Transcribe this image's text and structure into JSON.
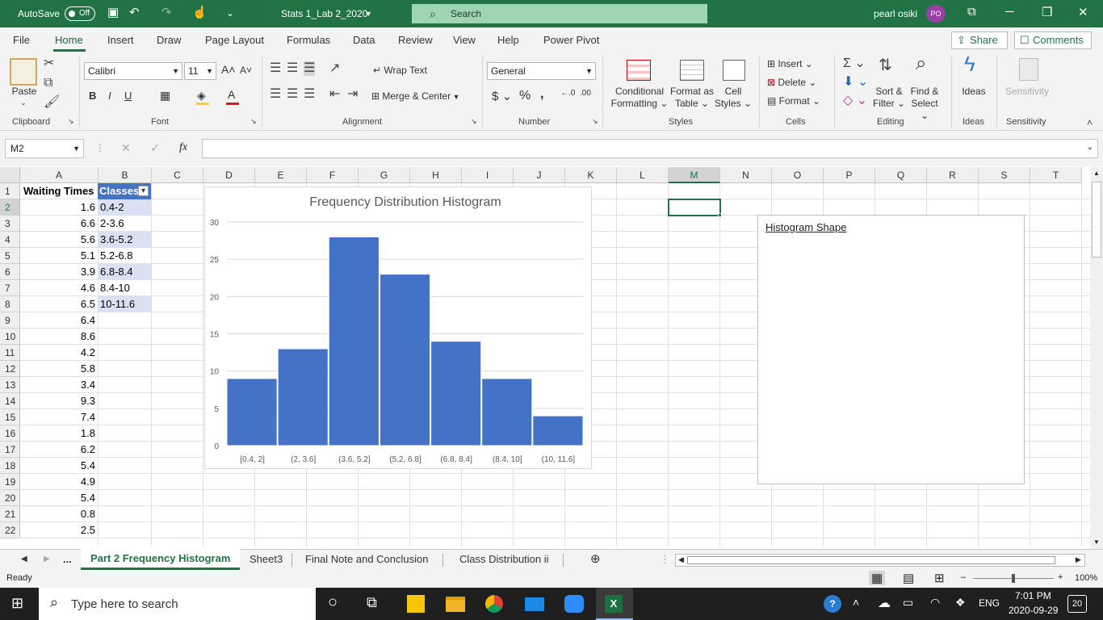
{
  "titlebar": {
    "autosave_label": "AutoSave",
    "autosave_state": "Off",
    "doc_title": "Stats 1_Lab 2_2020",
    "search_placeholder": "Search",
    "user_name": "pearl osiki",
    "user_initials": "PO",
    "bg_color": "#217346"
  },
  "menu": {
    "tabs": [
      "File",
      "Home",
      "Insert",
      "Draw",
      "Page Layout",
      "Formulas",
      "Data",
      "Review",
      "View",
      "Help",
      "Power Pivot"
    ],
    "active": "Home",
    "share_label": "Share",
    "comments_label": "Comments"
  },
  "ribbon": {
    "clipboard": {
      "paste": "Paste",
      "label": "Clipboard"
    },
    "font": {
      "name": "Calibri",
      "size": "11",
      "label": "Font",
      "bold": "B",
      "italic": "I",
      "underline": "U"
    },
    "alignment": {
      "wrap": "Wrap Text",
      "merge": "Merge & Center",
      "label": "Alignment"
    },
    "number": {
      "format": "General",
      "label": "Number"
    },
    "styles": {
      "conditional": "Conditional",
      "conditional2": "Formatting",
      "format_as": "Format as",
      "format_as2": "Table",
      "cell": "Cell",
      "cell2": "Styles",
      "label": "Styles"
    },
    "cells": {
      "insert": "Insert",
      "delete": "Delete",
      "format": "Format",
      "label": "Cells"
    },
    "editing": {
      "sort": "Sort &",
      "sort2": "Filter",
      "find": "Find &",
      "find2": "Select",
      "label": "Editing"
    },
    "ideas": {
      "btn": "Ideas",
      "label": "Ideas"
    },
    "sensitivity": {
      "btn": "Sensitivity",
      "label": "Sensitivity"
    }
  },
  "formula_bar": {
    "name_box": "M2",
    "fx": "fx",
    "value": ""
  },
  "grid": {
    "columns": [
      "A",
      "B",
      "C",
      "D",
      "E",
      "F",
      "G",
      "H",
      "I",
      "J",
      "K",
      "L",
      "M",
      "N",
      "O",
      "P",
      "Q",
      "R",
      "S",
      "T"
    ],
    "rows": [
      "1",
      "2",
      "3",
      "4",
      "5",
      "6",
      "7",
      "8",
      "9",
      "10",
      "11",
      "12",
      "13",
      "14",
      "15",
      "16",
      "17",
      "18",
      "19",
      "20",
      "21",
      "22"
    ],
    "header_a": "Waiting Times",
    "header_b": "Classes",
    "waiting_times": [
      "1.6",
      "6.6",
      "5.6",
      "5.1",
      "3.9",
      "4.6",
      "6.5",
      "6.4",
      "8.6",
      "4.2",
      "5.8",
      "3.4",
      "9.3",
      "7.4",
      "1.8",
      "6.2",
      "5.4",
      "4.9",
      "5.4",
      "0.8",
      "2.5"
    ],
    "classes": [
      "0.4-2",
      "2-3.6",
      "3.6-5.2",
      "5.2-6.8",
      "6.8-8.4",
      "8.4-10",
      "10-11.6"
    ],
    "selected_cell": "M2",
    "selected_col": "M"
  },
  "chart_data": {
    "type": "bar",
    "title": "Frequency Distribution Histogram",
    "categories": [
      "[0.4, 2]",
      "(2, 3.6]",
      "(3.6, 5.2]",
      "(5.2, 6.8]",
      "(6.8, 8.4]",
      "(8.4, 10]",
      "(10, 11.6]"
    ],
    "values": [
      9,
      13,
      28,
      23,
      14,
      9,
      4
    ],
    "ylim": [
      0,
      30
    ],
    "yticks": [
      "0",
      "5",
      "10",
      "15",
      "20",
      "25",
      "30"
    ],
    "grid": true,
    "color": "#4472c4"
  },
  "textbox": {
    "title": "Histogram Shape"
  },
  "sheets": {
    "tabs": [
      "Part 2 Frequency Histogram",
      "Sheet3",
      "Final Note and Conclusion",
      "Class Distribution ii"
    ],
    "active": "Part 2 Frequency Histogram",
    "ellipsis": "..."
  },
  "status": {
    "ready": "Ready",
    "zoom": "100%"
  },
  "taskbar": {
    "search_placeholder": "Type here to search",
    "lang": "ENG",
    "time": "7:01 PM",
    "date": "2020-09-29",
    "notifications": "20"
  }
}
